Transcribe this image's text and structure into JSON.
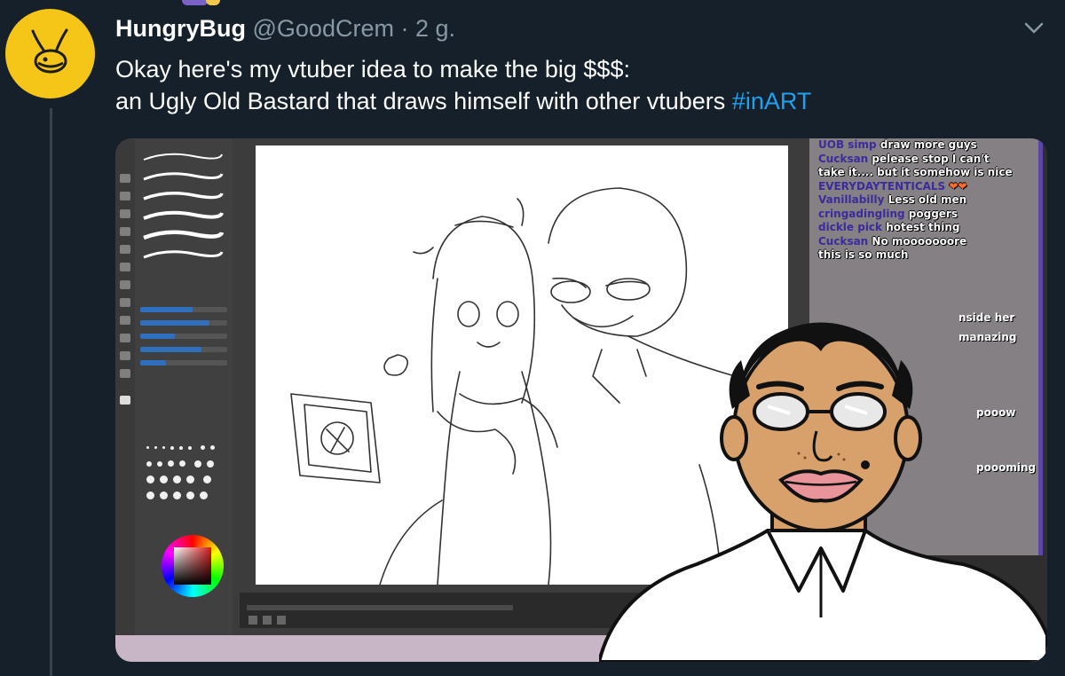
{
  "tweet": {
    "display_name": "HungryBug",
    "handle": "@GoodCrem",
    "separator": "·",
    "time": "2 g.",
    "text_line1": "Okay here's my vtuber idea to make the big $$$:",
    "text_line2_prefix": "an Ugly Old Bastard that draws himself with other vtubers",
    "hashtag": "#inART",
    "avatar_icon": "bug-icon",
    "menu_icon": "chevron-down-icon"
  },
  "chat": [
    {
      "user": "UOB simp",
      "msg": "draw more guys"
    },
    {
      "user": "Cucksan",
      "msg": "pelease stop I can't"
    },
    {
      "user": "",
      "msg": "take it.... but it somehow is nice"
    },
    {
      "user": "EVERYDAYTENTICALS",
      "msg": ""
    },
    {
      "user": "Vanillabilly",
      "msg": "Less old men"
    },
    {
      "user": "cringadingling",
      "msg": "poggers"
    },
    {
      "user": "dickle pick",
      "msg": "hotest thing"
    },
    {
      "user": "Cucksan",
      "msg": "No mooooooore"
    },
    {
      "user": "",
      "msg": "this is so much"
    }
  ],
  "chat_fragments": [
    "nside her",
    "manazing",
    "pooow",
    "poooming"
  ],
  "colors": {
    "background": "#15202b",
    "secondary_text": "#8899a6",
    "link": "#1da1f2",
    "avatar_bg": "#f5c518",
    "chat_bg": "#848083",
    "chat_user": "#3c2b9c",
    "chat_border": "#5b45a8"
  }
}
